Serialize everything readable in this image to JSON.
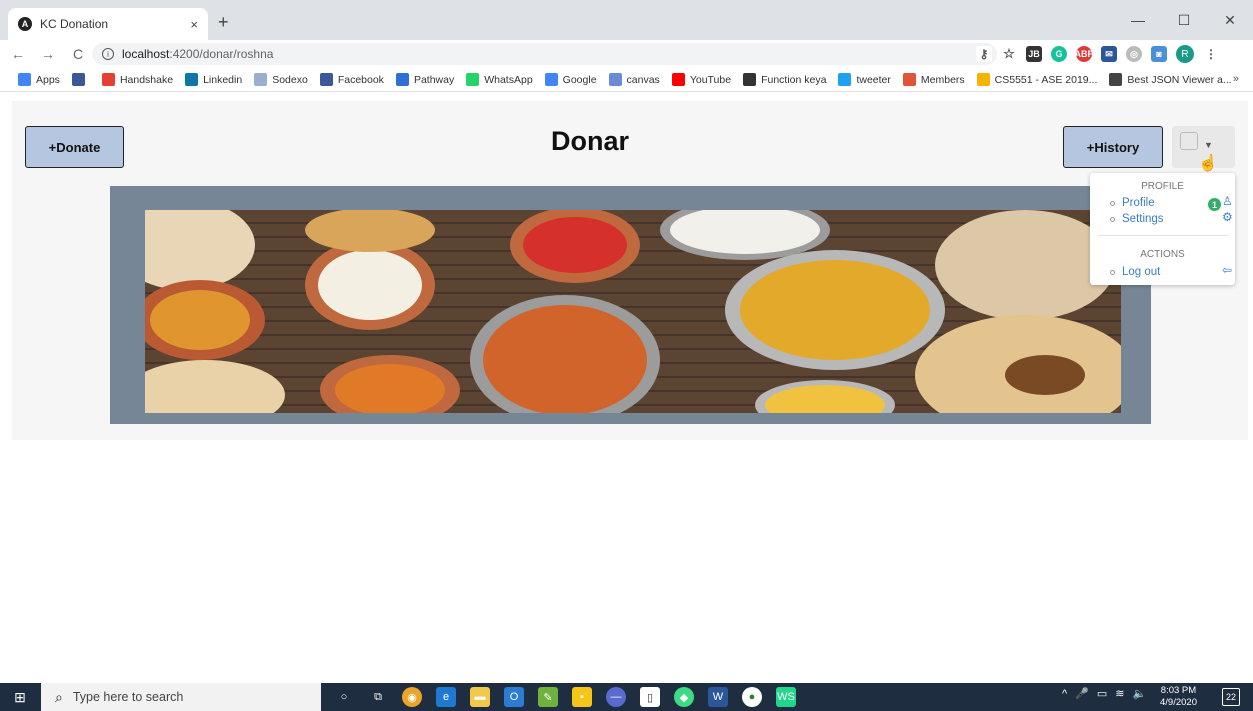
{
  "browser": {
    "tab_title": "KC Donation",
    "tab_close": "×",
    "new_tab": "+",
    "window_controls": [
      "—",
      "☐",
      "✕"
    ],
    "url_host": "localhost",
    "url_path": ":4200/donar/roshna",
    "nav": [
      "←",
      "→",
      "C"
    ],
    "bookmarks": [
      {
        "label": "Apps",
        "icon": "apps-grid-icon",
        "color": "#4285f4"
      },
      {
        "label": "",
        "icon": "facebook-icon",
        "color": "#3b5998"
      },
      {
        "label": "Handshake",
        "icon": "handshake-icon",
        "color": "#e34133"
      },
      {
        "label": "Linkedin",
        "icon": "linkedin-icon",
        "color": "#0e76a8"
      },
      {
        "label": "Sodexo",
        "icon": "sodexo-icon",
        "color": "#9aaed0"
      },
      {
        "label": "Facebook",
        "icon": "facebook-icon",
        "color": "#3b5998"
      },
      {
        "label": "Pathway",
        "icon": "pathway-icon",
        "color": "#2f6fd6"
      },
      {
        "label": "WhatsApp",
        "icon": "whatsapp-icon",
        "color": "#25d366"
      },
      {
        "label": "Google",
        "icon": "google-icon",
        "color": "#4285f4"
      },
      {
        "label": "canvas",
        "icon": "canvas-icon",
        "color": "#6b8bd6"
      },
      {
        "label": "YouTube",
        "icon": "youtube-icon",
        "color": "#ff0000"
      },
      {
        "label": "Function keya",
        "icon": "function-icon",
        "color": "#333333"
      },
      {
        "label": "tweeter",
        "icon": "twitter-icon",
        "color": "#1da1f2"
      },
      {
        "label": "Members",
        "icon": "members-icon",
        "color": "#e0553a"
      },
      {
        "label": "CS5551 - ASE 2019...",
        "icon": "drive-icon",
        "color": "#f4b400"
      },
      {
        "label": "Best JSON Viewer a...",
        "icon": "cb-icon",
        "color": "#444444"
      }
    ],
    "bookmarks_more": "»",
    "profile_initial": "R"
  },
  "page": {
    "title": "Donar",
    "donate_label": "+Donate",
    "history_label": "+History"
  },
  "dropdown": {
    "profile_header": "PROFILE",
    "profile_label": "Profile",
    "profile_badge": "1",
    "settings_label": "Settings",
    "actions_header": "ACTIONS",
    "logout_label": "Log out"
  },
  "taskbar": {
    "search_placeholder": "Type here to search",
    "time": "8:03 PM",
    "date": "4/9/2020",
    "notifications": "22"
  },
  "colors": {
    "button_bg": "#b5c6e0",
    "banner_frame": "#768696",
    "link_blue": "#3a7ec6",
    "badge_green": "#32b067",
    "taskbar_bg": "#1e2d40"
  }
}
